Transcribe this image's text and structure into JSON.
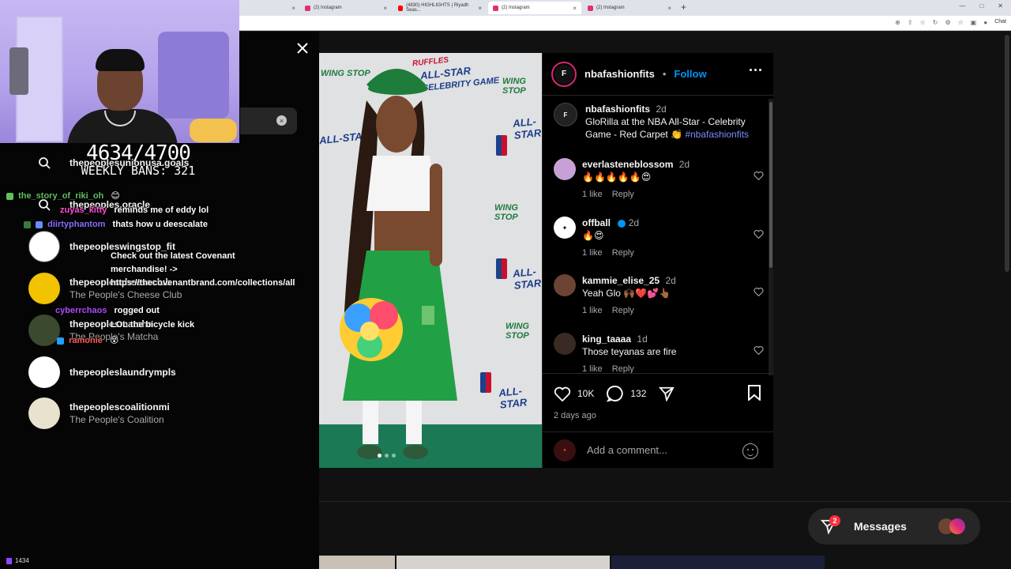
{
  "browser": {
    "tabs": [
      {
        "label": "(2) Instagram",
        "favicon": "instagram-icon"
      },
      {
        "label": "(4830) HIGHLIGHTS | Riyadh Seas...",
        "favicon": "youtube-icon"
      },
      {
        "label": "(2) Instagram",
        "favicon": "instagram-icon"
      },
      {
        "label": "(2) Instagram",
        "favicon": "instagram-icon"
      }
    ],
    "chat_button": "Chat"
  },
  "stream": {
    "counter_big": "4634/4700",
    "counter_small": "WEEKLY BANS: 321",
    "viewer_count": "1434"
  },
  "search_results": [
    {
      "username": "thepeoplesunionusa.goals",
      "subtitle": ""
    },
    {
      "username": "thepeoples.oracle",
      "subtitle": ""
    },
    {
      "username": "thepeopleswingstop_fit",
      "subtitle": ""
    },
    {
      "username": "thepeoplescheeseclub",
      "subtitle": "The People's Cheese Club"
    },
    {
      "username": "thepeoplesmatcha",
      "subtitle": "The People's Matcha"
    },
    {
      "username": "thepeopleslaundrympls",
      "subtitle": ""
    },
    {
      "username": "thepeoplescoalitionmi",
      "subtitle": "The People's Coalition"
    }
  ],
  "chat": [
    {
      "name": "the_story_of_riki_oh",
      "color": "#5fbf5f",
      "msg": "😊"
    },
    {
      "name": "zuyas_kitty",
      "color": "#ff4fd0",
      "msg": "reminds me of eddy lol"
    },
    {
      "name": "diirtyphantom",
      "color": "#8a6bff",
      "msg": "thats how u deescalate"
    },
    {
      "name": "",
      "color": "#ffffff",
      "msg": "Check out the latest Covenant merchandise! -> https://thecovenantbrand.com/collections/all"
    },
    {
      "name": "cyberrchaos",
      "color": "#b04bff",
      "msg": "rogged out"
    },
    {
      "name": "",
      "color": "#ffffff",
      "msg": "LOL the bicycle kick"
    },
    {
      "name": "ramonie",
      "color": "#ff5c5c",
      "msg": "😵"
    }
  ],
  "post": {
    "username": "nbafashionfits",
    "follow_label": "Follow",
    "caption_user": "nbafashionfits",
    "caption_time": "2d",
    "caption_text": "GloRilla at the NBA All-Star - Celebrity Game - Red Carpet 👏",
    "caption_tag": "#nbafashionfits",
    "comments": [
      {
        "user": "everlasteneblossom",
        "time": "2d",
        "text": "🔥🔥🔥🔥🔥😍",
        "likes": "1 like",
        "reply": "Reply",
        "verified": false
      },
      {
        "user": "offball",
        "time": "2d",
        "text": "🔥😍",
        "likes": "1 like",
        "reply": "Reply",
        "verified": true
      },
      {
        "user": "kammie_elise_25",
        "time": "2d",
        "text": "Yeah Glo 🙌🏾❤️💕👆🏾",
        "likes": "1 like",
        "reply": "Reply",
        "verified": false
      },
      {
        "user": "king_taaaa",
        "time": "1d",
        "text": "Those teyanas are fire",
        "likes": "1 like",
        "reply": "Reply",
        "verified": false
      }
    ],
    "like_count": "10K",
    "comment_count": "132",
    "posted": "2 days ago",
    "add_comment_placeholder": "Add a comment...",
    "backdrop": {
      "brand1": "RUFFLES",
      "brand2": "ALL-STAR",
      "brand3": "CELEBRITY GAME",
      "sponsor": "WING STOP"
    }
  },
  "messages": {
    "label": "Messages",
    "badge": "2"
  }
}
